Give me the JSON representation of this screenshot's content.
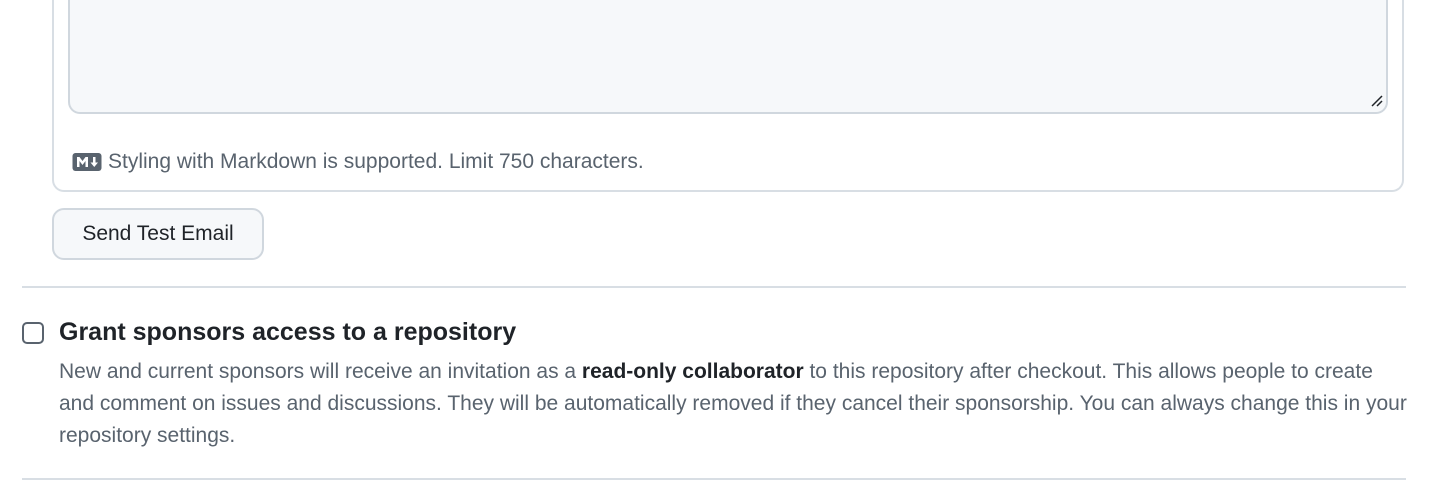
{
  "message_editor": {
    "textarea_value": "",
    "markdown_icon": "markdown-icon",
    "note": "Styling with Markdown is supported. Limit 750 characters."
  },
  "test_email": {
    "button_label": "Send Test Email"
  },
  "repo_access": {
    "checked": false,
    "title": "Grant sponsors access to a repository",
    "description_before": "New and current sponsors will receive an invitation as a ",
    "description_bold": "read-only collaborator",
    "description_after": " to this repository after checkout. This allows people to create and comment on issues and discussions. They will be automatically removed if they cancel their sponsorship. You can always change this in your repository settings."
  },
  "colors": {
    "muted_text": "#59636e",
    "primary_text": "#1f2328",
    "border": "#d0d7de",
    "input_bg": "#f6f8fa"
  }
}
